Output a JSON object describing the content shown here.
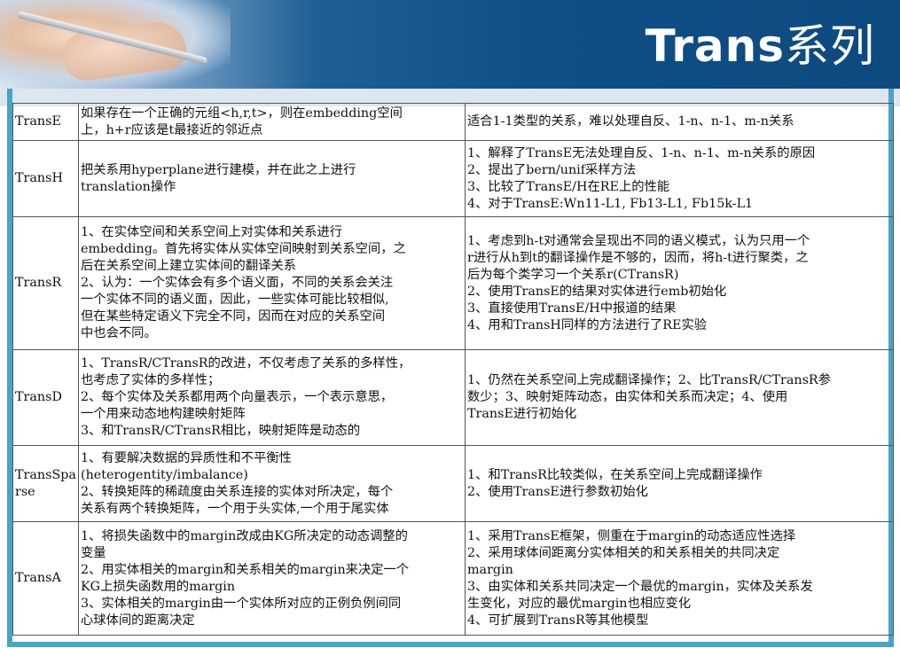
{
  "title": {
    "latin": "Trans",
    "cn": "系列"
  },
  "rows": [
    {
      "name": "TransE",
      "desc": [
        "如果存在一个正确的元组<h,r,t>，则在embedding空间",
        "上，h+r应该是t最接近的邻近点"
      ],
      "notes": [
        "适合1-1类型的关系，难以处理自反、1-n、n-1、m-n关系"
      ]
    },
    {
      "name": "TransH",
      "desc": [
        "把关系用hyperplane进行建模，并在此之上进行",
        "translation操作"
      ],
      "notes": [
        "1、解释了TransE无法处理自反、1-n、n-1、m-n关系的原因",
        "2、提出了bern/unif采样方法",
        "3、比较了TransE/H在RE上的性能",
        "4、对于TransE:Wn11-L1, Fb13-L1, Fb15k-L1"
      ]
    },
    {
      "name": "TransR",
      "desc": [
        "1、在实体空间和关系空间上对实体和关系进行",
        "embedding。首先将实体从实体空间映射到关系空间，之",
        "后在关系空间上建立实体间的翻译关系",
        "2、认为：一个实体会有多个语义面，不同的关系会关注",
        "一个实体不同的语义面，因此，一些实体可能比较相似,",
        "但在某些特定语义下完全不同，因而在对应的关系空间",
        "中也会不同。"
      ],
      "notes": [
        "1、考虑到h-t对通常会呈现出不同的语义模式，认为只用一个",
        "r进行从h到t的翻译操作是不够的，因而，将h-t进行聚类，之",
        "后为每个类学习一个关系r(CTransR)",
        "2、使用TransE的结果对实体进行emb初始化",
        "3、直接使用TransE/H中报道的结果",
        "4、用和TransH同样的方法进行了RE实验"
      ]
    },
    {
      "name": "TransD",
      "desc": [
        "1、TransR/CTransR的改进，不仅考虑了关系的多样性，",
        "也考虑了实体的多样性；",
        "2、每个实体及关系都用两个向量表示，一个表示意思，",
        "一个用来动态地构建映射矩阵",
        "3、和TransR/CTransR相比，映射矩阵是动态的"
      ],
      "notes": [
        "1、仍然在关系空间上完成翻译操作；2、比TransR/CTransR参",
        "数少；3、映射矩阵动态，由实体和关系而决定；4、使用",
        "TransE进行初始化"
      ]
    },
    {
      "name": [
        "TransSpa",
        "rse"
      ],
      "desc": [
        "1、有要解决数据的异质性和不平衡性",
        "(heterogentity/imbalance)",
        "2、转换矩阵的稀疏度由关系连接的实体对所决定，每个",
        "关系有两个转换矩阵，一个用于头实体,一个用于尾实体"
      ],
      "notes": [
        "1、和TransR比较类似，在关系空间上完成翻译操作",
        "2、使用TransE进行参数初始化"
      ]
    },
    {
      "name": "TransA",
      "desc": [
        "1、将损失函数中的margin改成由KG所决定的动态调整的",
        "变量",
        "2、用实体相关的margin和关系相关的margin来决定一个",
        "KG上损失函数用的margin",
        "3、实体相关的margin由一个实体所对应的正例负例间同",
        "心球体间的距离决定"
      ],
      "notes": [
        "1、采用TransE框架，侧重在于margin的动态适应性选择",
        "2、采用球体间距离分实体相关的和关系相关的共同决定",
        "margin",
        "3、由实体和关系共同决定一个最优的margin，实体及关系发",
        "生变化，对应的最优margin也相应变化",
        "4、可扩展到TransR等其他模型"
      ]
    }
  ]
}
